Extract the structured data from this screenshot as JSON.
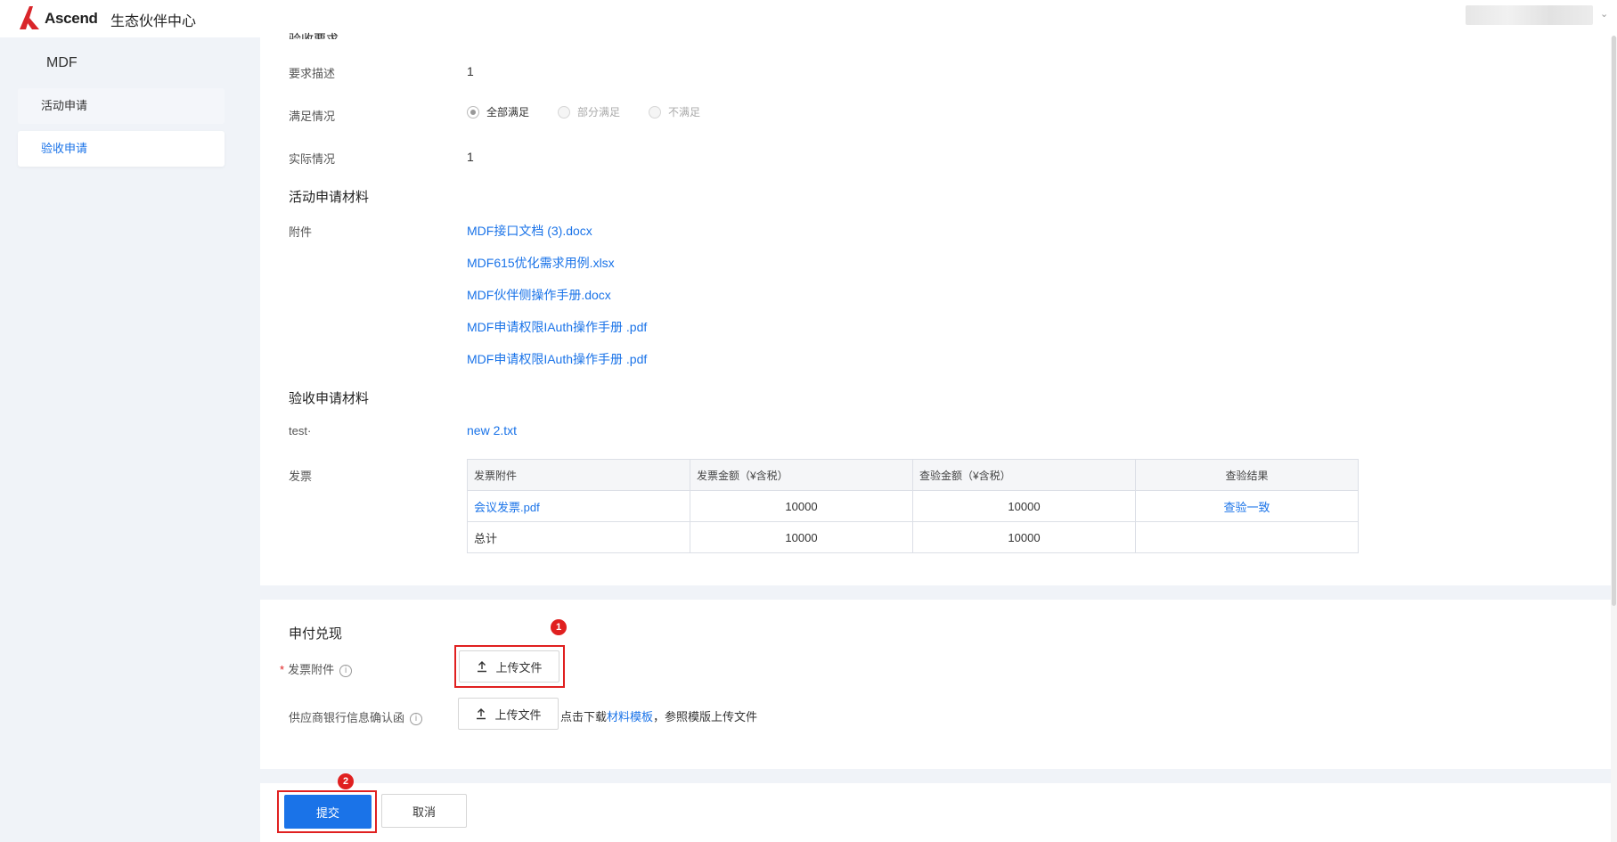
{
  "header": {
    "brand": "Ascend",
    "center_name": "生态伙伴中心",
    "user_menu_caret": "⌄",
    "brand_color": "#d9252a"
  },
  "sidebar": {
    "title": "MDF",
    "items": [
      {
        "label": "活动申请",
        "active": false
      },
      {
        "label": "验收申请",
        "active": true
      }
    ]
  },
  "acceptance": {
    "section_partial": "验收要求",
    "desc_label": "要求描述",
    "desc_value": "1",
    "satisfaction_label": "满足情况",
    "options": [
      {
        "label": "全部满足",
        "checked": true
      },
      {
        "label": "部分满足",
        "checked": false
      },
      {
        "label": "不满足",
        "checked": false
      }
    ],
    "actual_label": "实际情况",
    "actual_value": "1"
  },
  "activity_materials": {
    "title": "活动申请材料",
    "attach_label": "附件",
    "files": [
      "MDF接口文档 (3).docx",
      "MDF615优化需求用例.xlsx",
      "MDF伙伴侧操作手册.docx",
      "MDF申请权限IAuth操作手册 .pdf",
      "MDF申请权限IAuth操作手册 .pdf"
    ]
  },
  "acceptance_materials": {
    "title": "验收申请材料",
    "test_label": "test·",
    "test_file": "new 2.txt",
    "invoice_label": "发票",
    "table": {
      "headers": [
        "发票附件",
        "发票金额（¥含税）",
        "查验金额（¥含税）",
        "查验结果"
      ],
      "rows": [
        {
          "file": "会议发票.pdf",
          "amount": "10000",
          "checked_amount": "10000",
          "result": "查验一致"
        },
        {
          "file": "总计",
          "amount": "10000",
          "checked_amount": "10000",
          "result": ""
        }
      ]
    }
  },
  "payment": {
    "title": "申付兑现",
    "required_mark": "*",
    "invoice_attach_label": "发票附件",
    "upload_label": "上传文件",
    "bank_label": "供应商银行信息确认函",
    "hint_prefix": "点击下载",
    "hint_link": "材料模板",
    "hint_suffix": "，参照模版上传文件",
    "info_icon_glyph": "i",
    "badge1": "1",
    "badge2": "2"
  },
  "footer": {
    "submit_label": "提交",
    "cancel_label": "取消"
  }
}
